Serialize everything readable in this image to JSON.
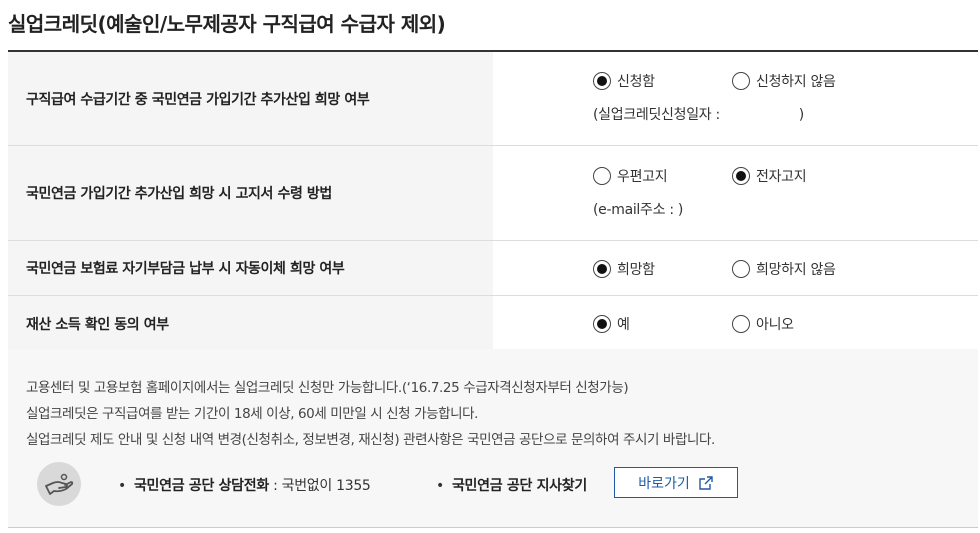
{
  "title": "실업크레딧(예술인/노무제공자 구직급여 수급자 제외)",
  "rows": [
    {
      "label": "구직급여 수급기간 중 국민연금 가입기간 추가산입 희망 여부",
      "options": [
        {
          "label": "신청함",
          "checked": true
        },
        {
          "label": "신청하지 않음",
          "checked": false
        }
      ],
      "sub_text": "(실업크레딧신청일자 :                   )"
    },
    {
      "label": "국민연금 가입기간 추가산입 희망 시 고지서 수령 방법",
      "options": [
        {
          "label": "우편고지",
          "checked": false
        },
        {
          "label": "전자고지",
          "checked": true
        }
      ],
      "sub_text": "(e-mail주소 : )"
    },
    {
      "label": "국민연금 보험료 자기부담금 납부 시 자동이체 희망 여부",
      "options": [
        {
          "label": "희망함",
          "checked": true
        },
        {
          "label": "희망하지 않음",
          "checked": false
        }
      ]
    },
    {
      "label": "재산 소득 확인 동의 여부",
      "options": [
        {
          "label": "예",
          "checked": true
        },
        {
          "label": "아니오",
          "checked": false
        }
      ]
    }
  ],
  "info": {
    "lines": [
      "고용센터 및 고용보험 홈페이지에서는 실업크레딧 신청만 가능합니다.(‘16.7.25 수급자격신청자부터 신청가능)",
      "실업크레딧은 구직급여를 받는 기간이 18세 이상, 60세 미만일 시 신청 가능합니다.",
      "실업크레딧 제도 안내 및 신청 내역 변경(신청취소, 정보변경, 재신청) 관련사항은 국민연금 공단으로 문의하여 주시기 바랍니다."
    ],
    "bullet": "•",
    "phone_label": "국민연금 공단 상담전화",
    "phone_value": " : 국번없이 1355",
    "branch_label": "국민연금 공단 지사찾기",
    "go_button": "바로가기",
    "icons": {
      "hand": "hand-support-icon",
      "external": "external-link-icon"
    }
  }
}
